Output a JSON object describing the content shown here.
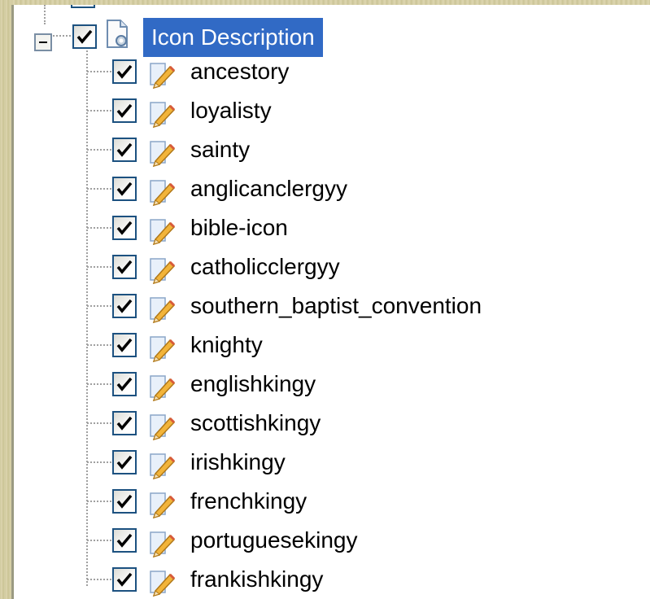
{
  "tree": {
    "root": {
      "label": "Icon Description",
      "checked": true,
      "expanded": true,
      "selected": true,
      "icon": "document-gear-icon"
    },
    "children": [
      {
        "label": "ancestory",
        "checked": true,
        "icon": "pencil-edit-icon"
      },
      {
        "label": "loyalisty",
        "checked": true,
        "icon": "pencil-edit-icon"
      },
      {
        "label": "sainty",
        "checked": true,
        "icon": "pencil-edit-icon"
      },
      {
        "label": "anglicanclergyy",
        "checked": true,
        "icon": "pencil-edit-icon"
      },
      {
        "label": "bible-icon",
        "checked": true,
        "icon": "pencil-edit-icon"
      },
      {
        "label": "catholicclergyy",
        "checked": true,
        "icon": "pencil-edit-icon"
      },
      {
        "label": "southern_baptist_convention",
        "checked": true,
        "icon": "pencil-edit-icon"
      },
      {
        "label": "knighty",
        "checked": true,
        "icon": "pencil-edit-icon"
      },
      {
        "label": "englishkingy",
        "checked": true,
        "icon": "pencil-edit-icon"
      },
      {
        "label": "scottishkingy",
        "checked": true,
        "icon": "pencil-edit-icon"
      },
      {
        "label": "irishkingy",
        "checked": true,
        "icon": "pencil-edit-icon"
      },
      {
        "label": "frenchkingy",
        "checked": true,
        "icon": "pencil-edit-icon"
      },
      {
        "label": "portuguesekingy",
        "checked": true,
        "icon": "pencil-edit-icon"
      },
      {
        "label": "frankishkingy",
        "checked": true,
        "icon": "pencil-edit-icon"
      }
    ]
  },
  "colors": {
    "selection": "#316ac5",
    "frame": "#d6cfa6",
    "checkbox_border": "#1c5180"
  }
}
